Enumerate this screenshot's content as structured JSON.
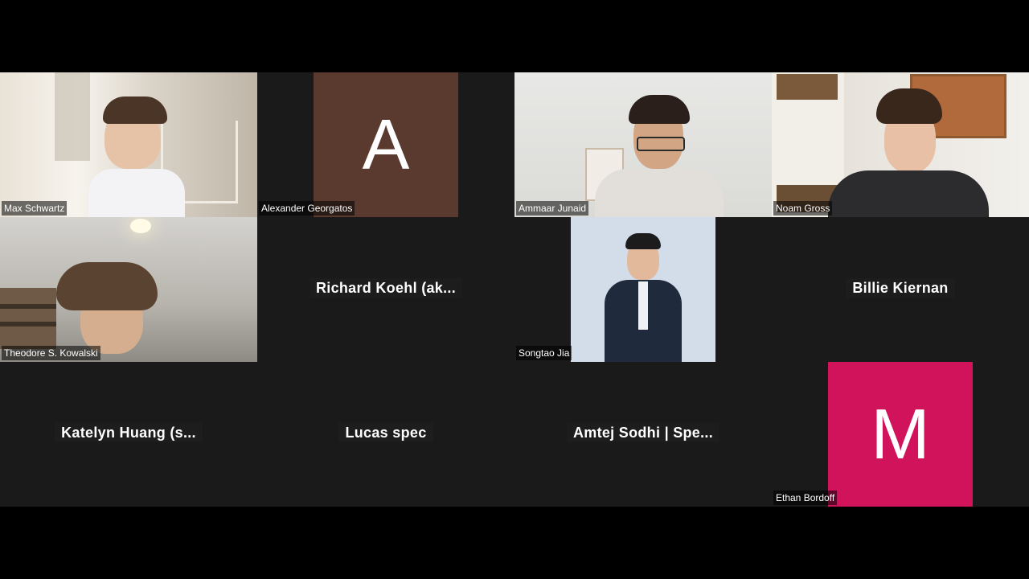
{
  "participants": [
    {
      "name": "Max Schwartz",
      "type": "video"
    },
    {
      "name": "Alexander Georgatos",
      "type": "avatar",
      "initial": "A",
      "color": "#5a3a2e"
    },
    {
      "name": "Ammaar Junaid",
      "type": "video"
    },
    {
      "name": "Noam Gross",
      "type": "video"
    },
    {
      "name": "Theodore S. Kowalski",
      "type": "video"
    },
    {
      "name": "Richard  Koehl  (ak...",
      "type": "name-only"
    },
    {
      "name": "Songtao Jia",
      "type": "photo"
    },
    {
      "name": "Billie Kiernan",
      "type": "name-only"
    },
    {
      "name": "Katelyn  Huang  (s...",
      "type": "name-only"
    },
    {
      "name": "Lucas spec",
      "type": "name-only"
    },
    {
      "name": "Amtej  Sodhi  |  Spe...",
      "type": "name-only"
    },
    {
      "name": "Ethan Bordoff",
      "type": "avatar",
      "initial": "M",
      "color": "#d1135b"
    }
  ],
  "colors": {
    "background": "#000000",
    "tile": "#1a1a1a"
  }
}
